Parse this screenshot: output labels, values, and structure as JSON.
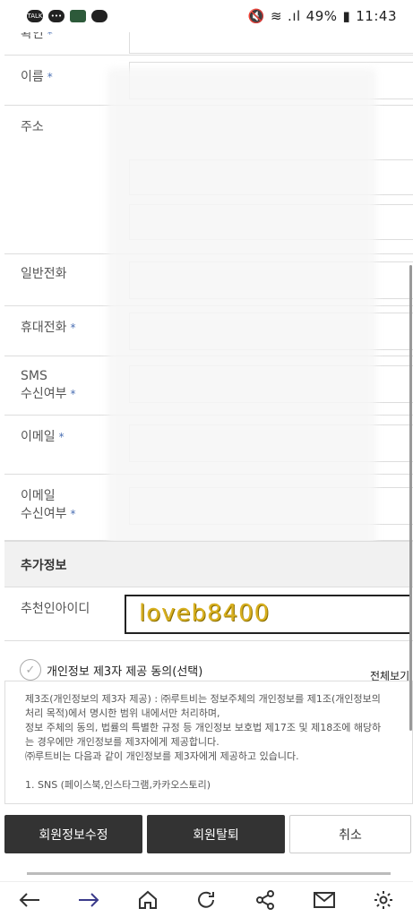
{
  "status": {
    "time": "11:43",
    "battery": "49%",
    "app_icons": [
      "TALK",
      "chat",
      "app",
      "cloud"
    ]
  },
  "form": {
    "confirm_label": "확인",
    "name_label": "이름",
    "address_label": "주소",
    "landline_label": "일반전화",
    "mobile_label": "휴대전화",
    "sms_label_1": "SMS",
    "sms_label_2": "수신여부",
    "email_label": "이메일",
    "email_opt_label_1": "이메일",
    "email_opt_label_2": "수신여부",
    "required_mark": "*"
  },
  "extra": {
    "section_title": "추가정보",
    "referrer_label": "추천인아이디",
    "referrer_value": "loveb8400"
  },
  "consent": {
    "title": "개인정보 제3자 제공 동의(선택)",
    "view_all": "전체보기",
    "lines": [
      "제3조(개인정보의 제3자 제공) : ㈜루트비는 정보주체의 개인정보를 제1조(개인정보의",
      "처리 목적)에서 명시한 범위 내에서만 처리하며,",
      "정보 주체의 동의, 법률의 특별한 규정 등 개인정보 보호법 제17조 및 제18조에 해당하",
      "는 경우에만 개인정보를 제3자에게 제공합니다.",
      "㈜루트비는 다음과 같이 개인정보를 제3자에게 제공하고 있습니다.",
      "",
      "1. SNS (페이스북,인스타그램,카카오스토리)"
    ]
  },
  "buttons": {
    "edit": "회원정보수정",
    "withdraw": "회원탈퇴",
    "cancel": "취소"
  },
  "nav_icons": [
    "back-arrow-icon",
    "forward-arrow-icon",
    "home-icon",
    "refresh-icon",
    "share-icon",
    "mail-icon",
    "settings-icon"
  ]
}
